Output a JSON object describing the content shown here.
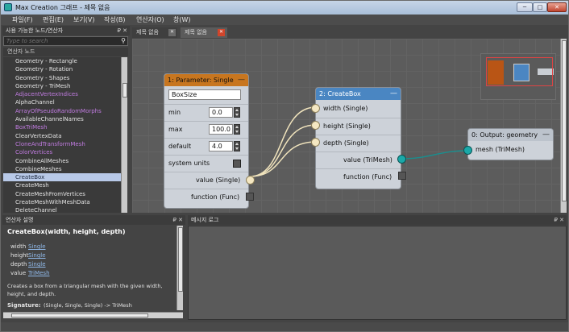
{
  "window": {
    "title": "Max Creation 그래프 - 제목 없음",
    "min_glyph": "─",
    "max_glyph": "□",
    "close_glyph": "✕"
  },
  "menu": [
    "파일(F)",
    "편집(E)",
    "보기(V)",
    "작성(B)",
    "연산자(O)",
    "창(W)"
  ],
  "left_panel": {
    "title": "사용 가능한 노드/연산자",
    "pin_glyph": "₽ ✕",
    "search_placeholder": "Type to search",
    "category": "연산자 노드",
    "items": [
      {
        "label": "Geometry - Rectangle",
        "style": "cat"
      },
      {
        "label": "Geometry - Rotation",
        "style": "cat"
      },
      {
        "label": "Geometry - Shapes",
        "style": "cat"
      },
      {
        "label": "Geometry - TriMesh",
        "style": "cat"
      },
      {
        "label": "AdjacentVertexIndices",
        "style": "purple"
      },
      {
        "label": "AlphaChannel",
        "style": "normal"
      },
      {
        "label": "ArrayOfPseudoRandomMorphs",
        "style": "purple"
      },
      {
        "label": "AvailableChannelNames",
        "style": "normal"
      },
      {
        "label": "BoxTriMesh",
        "style": "purple"
      },
      {
        "label": "ClearVertexData",
        "style": "normal"
      },
      {
        "label": "CloneAndTransformMesh",
        "style": "purple"
      },
      {
        "label": "ColorVertices",
        "style": "purple"
      },
      {
        "label": "CombineAllMeshes",
        "style": "normal"
      },
      {
        "label": "CombineMeshes",
        "style": "normal"
      },
      {
        "label": "CreateBox",
        "style": "sel"
      },
      {
        "label": "CreateMesh",
        "style": "normal"
      },
      {
        "label": "CreateMeshFromVertices",
        "style": "normal"
      },
      {
        "label": "CreateMeshWithMeshData",
        "style": "normal"
      },
      {
        "label": "DeleteChannel",
        "style": "normal"
      }
    ]
  },
  "tabs": [
    {
      "label": "제목 없음",
      "close": "✕",
      "active": false
    },
    {
      "label": "제목 없음",
      "close": "✕",
      "active": true
    }
  ],
  "nodes": {
    "param": {
      "title": "1: Parameter: Single",
      "min_glyph": "—",
      "name_value": "BoxSize",
      "min_label": "min",
      "min_value": "0.0",
      "max_label": "max",
      "max_value": "100.0",
      "default_label": "default",
      "default_value": "4.0",
      "system_units": "system units",
      "out_value": "value (Single)",
      "out_func": "function (Func)"
    },
    "createbox": {
      "title": "2: CreateBox",
      "min_glyph": "—",
      "in_width": "width (Single)",
      "in_height": "height (Single)",
      "in_depth": "depth (Single)",
      "out_value": "value (TriMesh)",
      "out_func": "function (Func)"
    },
    "output": {
      "title": "0: Output: geometry",
      "min_glyph": "—",
      "in_mesh": "mesh (TriMesh)"
    }
  },
  "colors": {
    "param_header": "#c8761f",
    "createbox_header": "#4a86c2",
    "output_header": "#bcc3cc",
    "wire": "#f1e4bd",
    "wire_mesh": "#1b8d8d"
  },
  "op_desc": {
    "title": "연산자 설명",
    "pin_glyph": "₽ ✕",
    "signature_title": "CreateBox(width, height, depth)",
    "params": [
      {
        "name": "width",
        "type": "Single"
      },
      {
        "name": "height",
        "type": "Single"
      },
      {
        "name": "depth",
        "type": "Single"
      },
      {
        "name": "value",
        "type": "TriMesh"
      }
    ],
    "desc_line1": "Creates a box from a triangular mesh with the given width,",
    "desc_line2": "height, and depth.",
    "sig_label": "Signature:",
    "sig_value": "(Single, Single, Single) -> TriMesh"
  },
  "msg_log": {
    "title": "메시지 로그",
    "pin_glyph": "₽ ✕"
  }
}
